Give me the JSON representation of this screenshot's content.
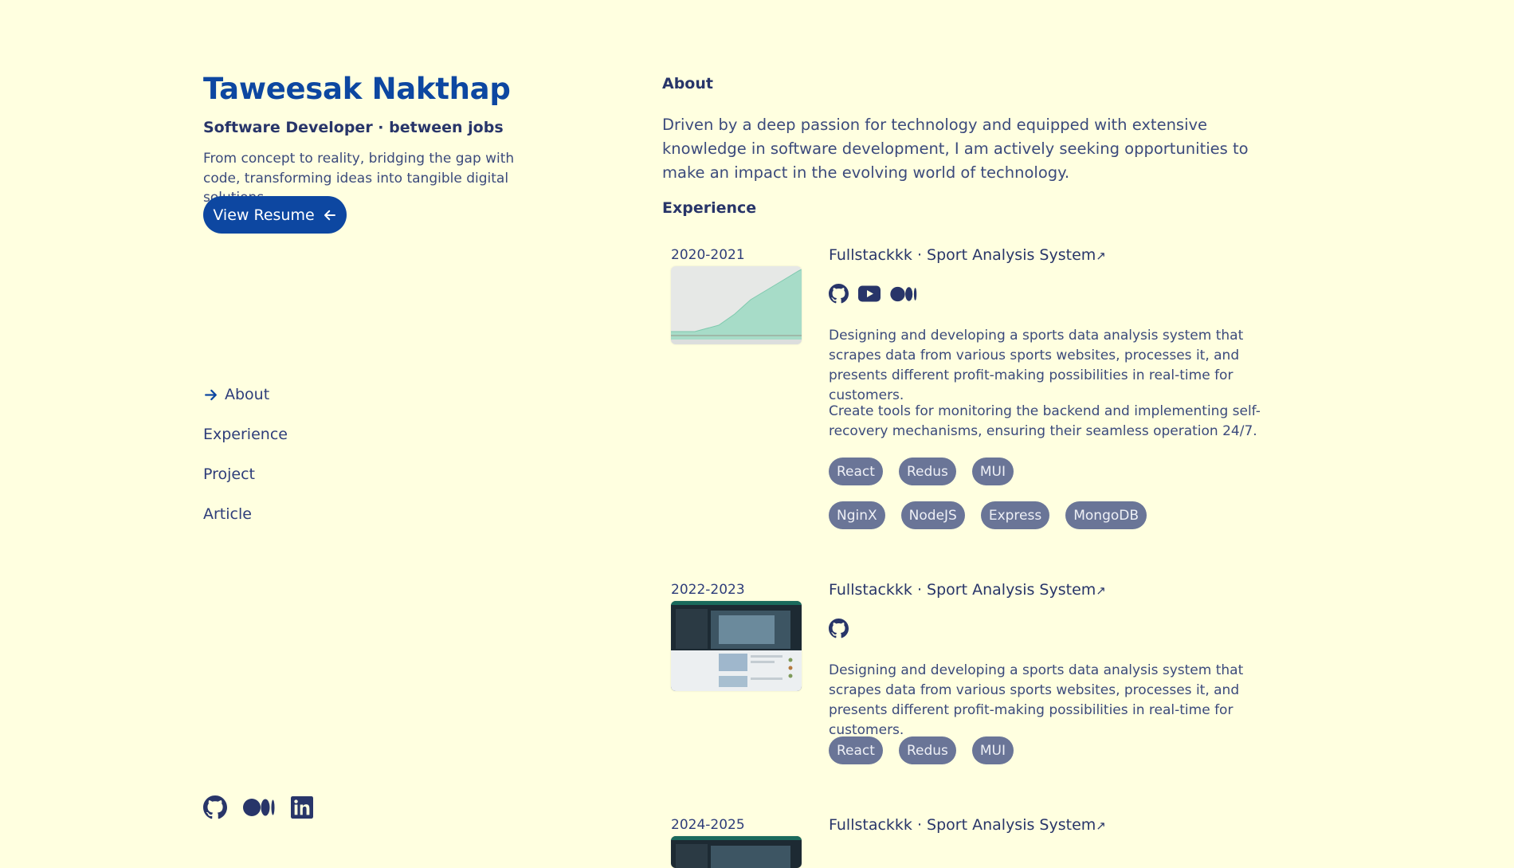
{
  "profile": {
    "name": "Taweesak Nakthap",
    "role": "Software Developer · between jobs",
    "tagline": "From concept to reality, bridging the gap with code, transforming ideas into tangible digital solutions.",
    "resume_button": "View Resume"
  },
  "nav": [
    {
      "label": "About",
      "active": true
    },
    {
      "label": "Experience"
    },
    {
      "label": "Project"
    },
    {
      "label": "Article"
    }
  ],
  "socials": [
    "github-icon",
    "medium-icon",
    "linkedin-icon"
  ],
  "about": {
    "heading": "About",
    "text": "Driven by a deep passion for technology and equipped with extensive knowledge in software development, I am actively seeking opportunities to make an impact in the evolving world of technology."
  },
  "experience": {
    "heading": "Experience",
    "items": [
      {
        "date": "2020-2021",
        "title": "Fullstackkk · Sport Analysis System",
        "icons": [
          "github-icon",
          "youtube-icon",
          "medium-icon"
        ],
        "desc": [
          "Designing and developing a sports data analysis system that scrapes data from various sports websites, processes it, and presents different profit-making possibilities in real-time for customers.",
          "Create tools for monitoring the backend and implementing self-recovery mechanisms, ensuring their seamless operation 24/7."
        ],
        "tags_row1": [
          "React",
          "Redus",
          "MUI"
        ],
        "tags_row2": [
          "NginX",
          "NodeJS",
          "Express",
          "MongoDB"
        ]
      },
      {
        "date": "2022-2023",
        "title": "Fullstackkk · Sport Analysis System",
        "icons": [
          "github-icon"
        ],
        "desc": [
          "Designing and developing a sports data analysis system that scrapes data from various sports websites, processes it, and presents different profit-making possibilities in real-time for customers."
        ],
        "tags_row1": [
          "React",
          "Redus",
          "MUI"
        ]
      },
      {
        "date": "2024-2025",
        "title": "Fullstackkk · Sport Analysis System"
      }
    ]
  },
  "colors": {
    "background": "#ffffe0",
    "accent": "#0d47a1",
    "text": "#2a3a7a",
    "tag_bg": "#6a7597"
  }
}
